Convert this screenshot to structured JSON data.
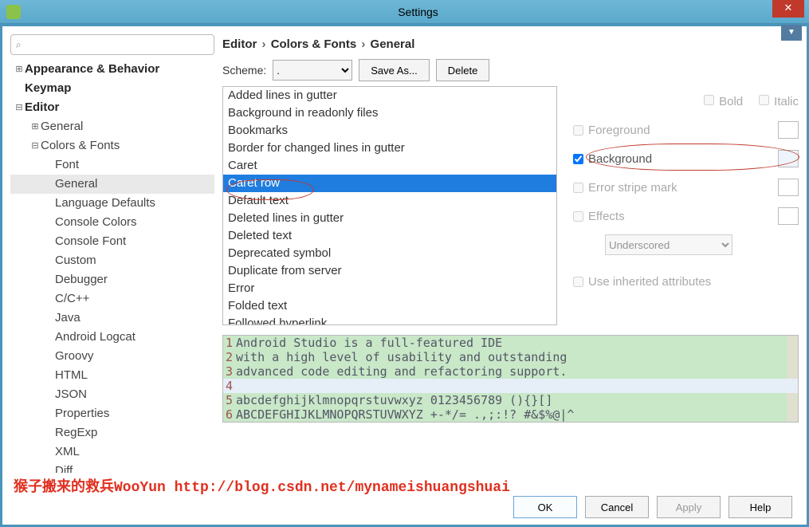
{
  "window": {
    "title": "Settings",
    "close_glyph": "✕"
  },
  "search": {
    "icon": "⌕",
    "placeholder": ""
  },
  "tree": {
    "items": [
      {
        "label": "Appearance & Behavior",
        "toggle": "⊞",
        "bold": true,
        "lvl": 0
      },
      {
        "label": "Keymap",
        "bold": true,
        "lvl": 0
      },
      {
        "label": "Editor",
        "toggle": "⊟",
        "bold": true,
        "lvl": 0
      },
      {
        "label": "General",
        "toggle": "⊞",
        "lvl": 1
      },
      {
        "label": "Colors & Fonts",
        "toggle": "⊟",
        "lvl": 1
      },
      {
        "label": "Font",
        "lvl": 2
      },
      {
        "label": "General",
        "lvl": 2,
        "sel": true
      },
      {
        "label": "Language Defaults",
        "lvl": 2
      },
      {
        "label": "Console Colors",
        "lvl": 2
      },
      {
        "label": "Console Font",
        "lvl": 2
      },
      {
        "label": "Custom",
        "lvl": 2
      },
      {
        "label": "Debugger",
        "lvl": 2
      },
      {
        "label": "C/C++",
        "lvl": 2
      },
      {
        "label": "Java",
        "lvl": 2
      },
      {
        "label": "Android Logcat",
        "lvl": 2
      },
      {
        "label": "Groovy",
        "lvl": 2
      },
      {
        "label": "HTML",
        "lvl": 2
      },
      {
        "label": "JSON",
        "lvl": 2
      },
      {
        "label": "Properties",
        "lvl": 2
      },
      {
        "label": "RegExp",
        "lvl": 2
      },
      {
        "label": "XML",
        "lvl": 2
      },
      {
        "label": "Diff",
        "lvl": 2
      }
    ]
  },
  "breadcrumb": {
    "a": "Editor",
    "b": "Colors & Fonts",
    "c": "General",
    "sep": "›"
  },
  "scheme": {
    "label": "Scheme:",
    "value": ".",
    "save_as": "Save As...",
    "delete": "Delete"
  },
  "attributes": {
    "items": [
      "Added lines in gutter",
      "Background in readonly files",
      "Bookmarks",
      "Border for changed lines in gutter",
      "Caret",
      "Caret row",
      "Default text",
      "Deleted lines in gutter",
      "Deleted text",
      "Deprecated symbol",
      "Duplicate from server",
      "Error",
      "Folded text",
      "Followed hyperlink"
    ],
    "selected_index": 5
  },
  "options": {
    "bold": "Bold",
    "italic": "Italic",
    "foreground": "Foreground",
    "background": "Background",
    "background_checked": true,
    "error_stripe": "Error stripe mark",
    "effects": "Effects",
    "effect_type": "Underscored",
    "inherit": "Use inherited attributes"
  },
  "preview": {
    "lines": [
      "Android Studio is a full-featured IDE",
      "with a high level of usability and outstanding",
      "advanced code editing and refactoring support.",
      "",
      "abcdefghijklmnopqrstuvwxyz 0123456789 (){}[]",
      "ABCDEFGHIJKLMNOPQRSTUVWXYZ +-*/= .,;:!? #&$%@|^"
    ],
    "caret_row_index": 3
  },
  "buttons": {
    "ok": "OK",
    "cancel": "Cancel",
    "apply": "Apply",
    "help": "Help"
  },
  "watermark": "猴子搬来的救兵WooYun http://blog.csdn.net/mynameishuangshuai"
}
